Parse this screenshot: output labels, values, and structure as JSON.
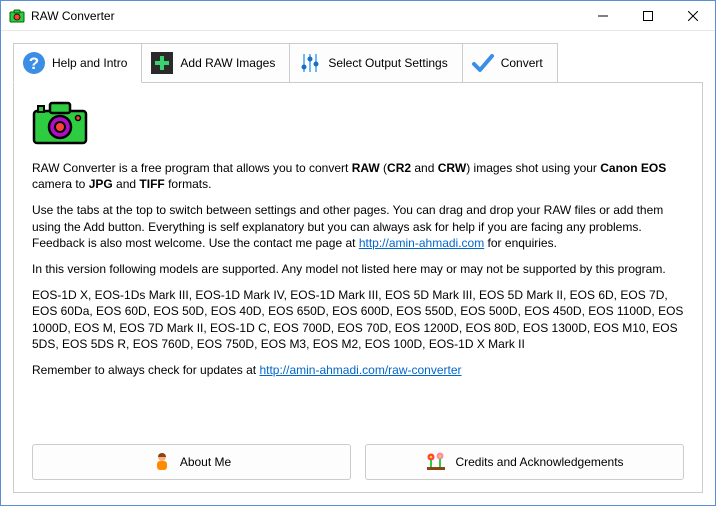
{
  "window": {
    "title": "RAW Converter"
  },
  "tabs": {
    "help": "Help and Intro",
    "add": "Add RAW Images",
    "output": "Select Output Settings",
    "convert": "Convert"
  },
  "intro": {
    "p1_a": "RAW Converter is a free program that allows you to convert ",
    "p1_b": "RAW",
    "p1_c": " (",
    "p1_d": "CR2",
    "p1_e": " and ",
    "p1_f": "CRW",
    "p1_g": ") images shot using your ",
    "p1_h": "Canon EOS",
    "p1_i": " camera to ",
    "p1_j": "JPG",
    "p1_k": " and ",
    "p1_l": "TIFF",
    "p1_m": " formats.",
    "p2_a": "Use the tabs at the top to switch between settings and other pages. You can drag and drop your RAW files or add them using the Add button. Everything is self explanatory but you can always ask for help if you are facing any problems. Feedback is also most welcome. Use the contact me page at ",
    "p2_link": "http://amin-ahmadi.com",
    "p2_b": " for enquiries.",
    "p3": "In this version following models are supported. Any model not listed here may or may not be supported by this program.",
    "p4": "EOS-1D X, EOS-1Ds Mark III, EOS-1D Mark IV, EOS-1D Mark III, EOS 5D Mark III, EOS 5D Mark II, EOS 6D, EOS 7D, EOS 60Da, EOS 60D, EOS 50D, EOS 40D, EOS 650D, EOS 600D, EOS 550D, EOS 500D, EOS 450D, EOS 1100D, EOS 1000D, EOS M, EOS 7D Mark II, EOS-1D C, EOS 700D, EOS 70D, EOS 1200D, EOS 80D, EOS 1300D, EOS M10, EOS 5DS, EOS 5DS R, EOS 760D, EOS 750D, EOS M3, EOS M2, EOS 100D, EOS-1D X Mark II",
    "p5_a": "Remember to always check for updates at ",
    "p5_link": "http://amin-ahmadi.com/raw-converter"
  },
  "buttons": {
    "about": "About Me",
    "credits": "Credits and Acknowledgements"
  }
}
